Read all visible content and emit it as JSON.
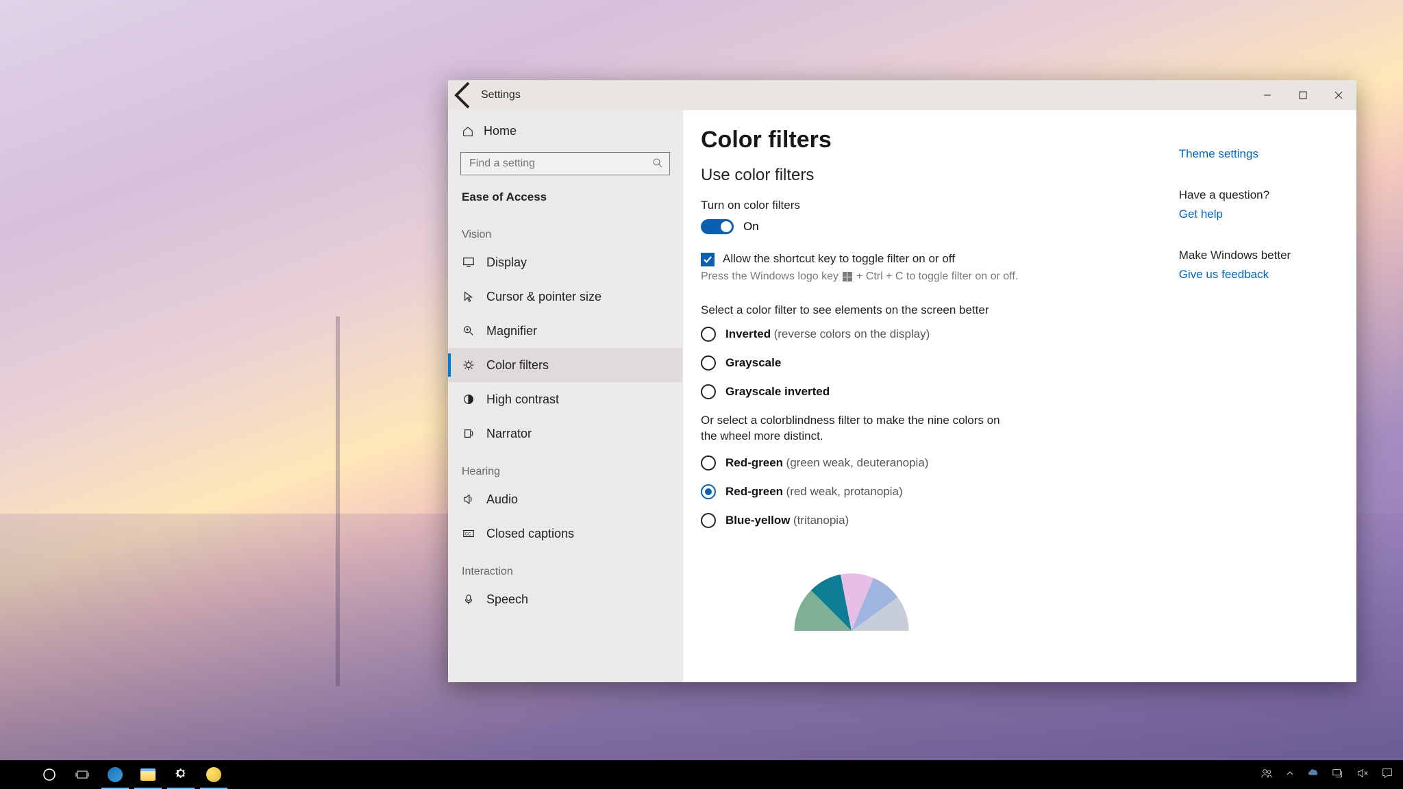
{
  "window": {
    "app_title": "Settings"
  },
  "sidebar": {
    "home": "Home",
    "search_placeholder": "Find a setting",
    "category": "Ease of Access",
    "groups": {
      "vision": "Vision",
      "hearing": "Hearing",
      "interaction": "Interaction"
    },
    "items": {
      "display": "Display",
      "cursor": "Cursor & pointer size",
      "magnifier": "Magnifier",
      "color_filters": "Color filters",
      "high_contrast": "High contrast",
      "narrator": "Narrator",
      "audio": "Audio",
      "closed_captions": "Closed captions",
      "speech": "Speech"
    }
  },
  "main": {
    "title": "Color filters",
    "subtitle": "Use color filters",
    "toggle_label": "Turn on color filters",
    "toggle_state": "On",
    "shortcut_checkbox": "Allow the shortcut key to toggle filter on or off",
    "shortcut_hint_pre": "Press the Windows logo key",
    "shortcut_hint_post": "+ Ctrl + C to toggle filter on or off.",
    "select_label": "Select a color filter to see elements on the screen better",
    "radios": {
      "inverted": {
        "main": "Inverted",
        "sub": "(reverse colors on the display)"
      },
      "grayscale": {
        "main": "Grayscale",
        "sub": ""
      },
      "grayscale_inv": {
        "main": "Grayscale inverted",
        "sub": ""
      }
    },
    "or_text": "Or select a colorblindness filter to make the nine colors on the wheel more distinct.",
    "cb_radios": {
      "deut": {
        "main": "Red-green",
        "sub": "(green weak, deuteranopia)"
      },
      "prot": {
        "main": "Red-green",
        "sub": "(red weak, protanopia)"
      },
      "trit": {
        "main": "Blue-yellow",
        "sub": "(tritanopia)"
      }
    }
  },
  "rail": {
    "theme": "Theme settings",
    "question": "Have a question?",
    "help": "Get help",
    "better": "Make Windows better",
    "feedback": "Give us feedback"
  }
}
